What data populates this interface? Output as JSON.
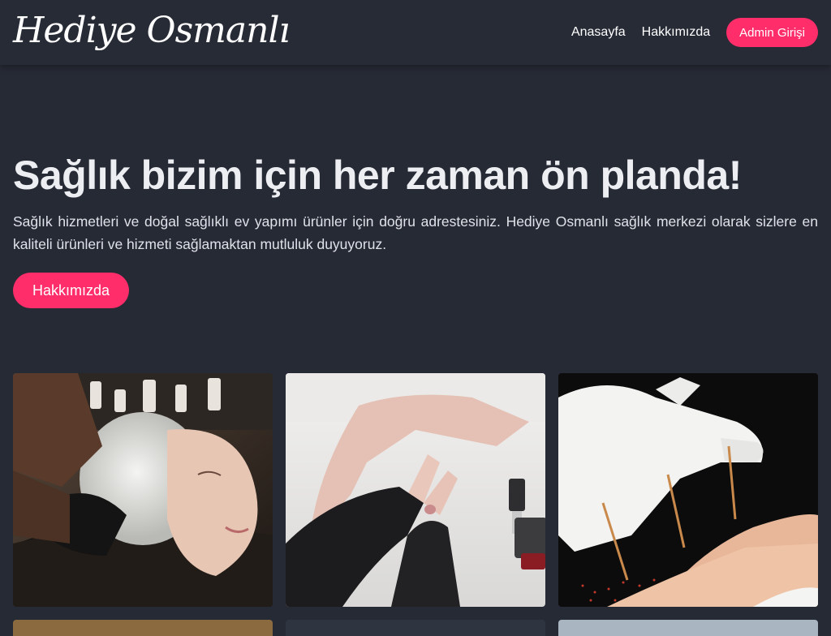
{
  "nav": {
    "logo_text": "Hediye Osmanlı",
    "links": [
      "Anasayfa",
      "Hakkımızda"
    ],
    "admin_label": "Admin Girişi"
  },
  "hero": {
    "title": "Sağlık bizim için her zaman ön planda!",
    "text": "Sağlık hizmetleri ve doğal sağlıklı ev yapımı ürünler için doğru adrestesiniz. Hediye Osmanlı sağlık merkezi olarak sizlere en kaliteli ürünleri ve hizmeti sağlamaktan mutluluk duyuyoruz.",
    "button_label": "Hakkımızda"
  },
  "colors": {
    "background": "#262a35",
    "accent": "#ff2d6a",
    "text": "#eceef2"
  },
  "gallery": [
    {
      "subject": "hair-wash-photo"
    },
    {
      "subject": "manicure-photo"
    },
    {
      "subject": "acupuncture-photo"
    }
  ]
}
